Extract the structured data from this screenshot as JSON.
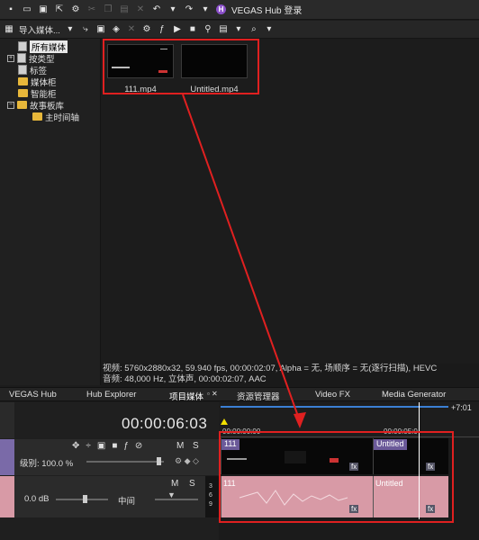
{
  "toolbar": {
    "hub_badge": "H",
    "hub_label": "VEGAS Hub 登录",
    "icons": [
      "new-icon",
      "open-icon",
      "save-icon",
      "export-icon",
      "settings-icon",
      "cut-icon",
      "copy-icon",
      "paste-icon",
      "delete-icon",
      "undo-icon",
      "redo-icon"
    ]
  },
  "media_toolbar": {
    "import_label": "导入媒体..."
  },
  "tree": {
    "items": [
      {
        "label": "所有媒体",
        "selected": true
      },
      {
        "label": "按类型",
        "expander": "+"
      },
      {
        "label": "标签"
      },
      {
        "label": "媒体柜"
      },
      {
        "label": "智能柜"
      },
      {
        "label": "故事板库",
        "expander": "−"
      },
      {
        "label": "主时间轴"
      }
    ]
  },
  "media": {
    "items": [
      {
        "label": "111.mp4"
      },
      {
        "label": "Untitled.mp4"
      }
    ]
  },
  "info": {
    "line1": "视频: 5760x2880x32, 59.940 fps, 00:00:02:07, Alpha = 无, 场顺序 = 无(逐行扫描), HEVC",
    "line2": "音频: 48,000 Hz, 立体声, 00:00:02:07, AAC"
  },
  "tabs": [
    "VEGAS Hub",
    "Hub Explorer",
    "项目媒体",
    "资源管理器",
    "Video FX",
    "Media Generator"
  ],
  "timeline": {
    "timecode": "00:00:06:03",
    "ruler_start": "00:00:00:00",
    "ruler_mark": "00:00:05:0",
    "offset": "+7:01",
    "video_track": {
      "level_label": "级别: 100.0 %",
      "m": "M",
      "s": "S"
    },
    "audio_track": {
      "db": "0.0 dB",
      "pan": "中间",
      "m": "M",
      "s": "S",
      "meter_ticks": [
        "3",
        "6",
        "9"
      ]
    },
    "clips": {
      "video1": "111",
      "video2": "Untitled",
      "audio1": "111",
      "audio2": "Untitled",
      "fx": "fx"
    }
  },
  "colors": {
    "annotation_red": "#e02020",
    "video_track": "#6b5a99",
    "audio_track": "#d89aa6"
  }
}
